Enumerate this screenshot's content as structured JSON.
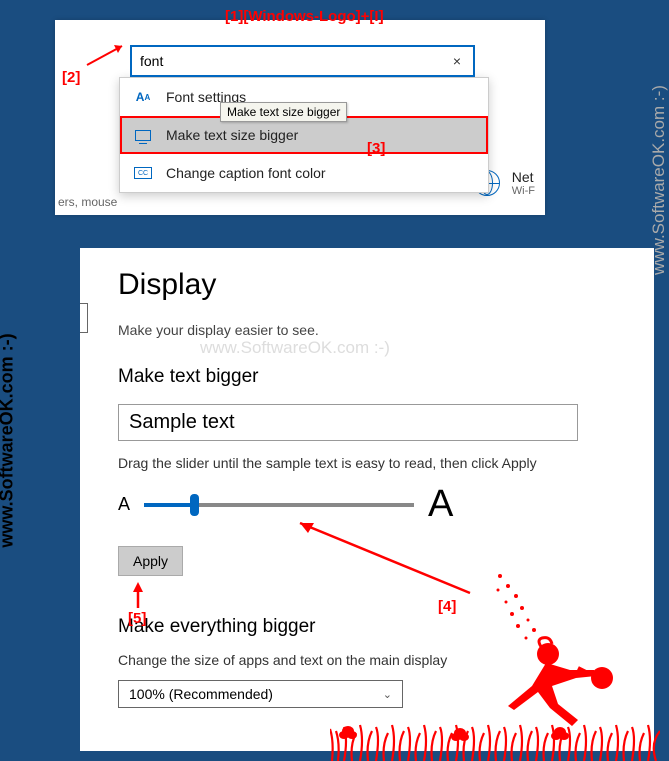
{
  "top_annotation": "[1][Windows-Logo]+[I]",
  "annotation2": "[2]",
  "annotation3": "[3]",
  "annotation4": "[4]",
  "annotation5": "[5]",
  "watermark": "www.SoftwareOK.com :-)",
  "search": {
    "value": "font",
    "clear_symbol": "×"
  },
  "dropdown": {
    "item1": "Font settings",
    "item2": "Make text size bigger",
    "item3": "Change caption font color",
    "tooltip": "Make text size bigger",
    "cc_label": "CC"
  },
  "panel1_frag": {
    "left": "ers, mouse",
    "net": "Net",
    "wifi": "Wi-F"
  },
  "display": {
    "title": "Display",
    "subtitle": "Make your display easier to see.",
    "section1": "Make text bigger",
    "sample": "Sample text",
    "slider_desc": "Drag the slider until the sample text is easy to read, then click Apply",
    "a_small": "A",
    "a_large": "A",
    "apply": "Apply",
    "section2": "Make everything bigger",
    "desc2": "Change the size of apps and text on the main display",
    "scale_value": "100% (Recommended)"
  }
}
